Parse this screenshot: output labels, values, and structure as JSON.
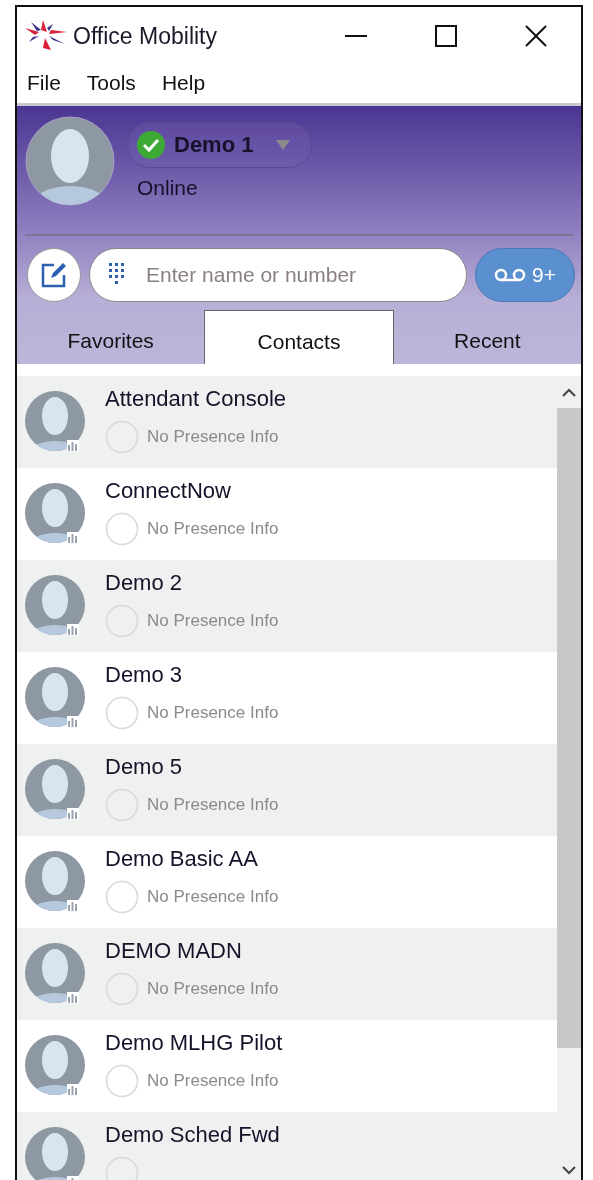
{
  "window": {
    "title": "Office Mobility"
  },
  "menu": [
    "File",
    "Tools",
    "Help"
  ],
  "profile": {
    "name": "Demo 1",
    "available": true,
    "status_text": "Online"
  },
  "search": {
    "placeholder": "Enter name or number"
  },
  "voicemail": {
    "count": "9+"
  },
  "tabs": [
    {
      "label": "Favorites",
      "selected": false
    },
    {
      "label": "Contacts",
      "selected": true
    },
    {
      "label": "Recent",
      "selected": false
    }
  ],
  "contacts": [
    {
      "name": "Attendant Console",
      "presence": "No Presence Info"
    },
    {
      "name": "ConnectNow",
      "presence": "No Presence Info"
    },
    {
      "name": "Demo 2",
      "presence": "No Presence Info"
    },
    {
      "name": "Demo 3",
      "presence": "No Presence Info"
    },
    {
      "name": "Demo 5",
      "presence": "No Presence Info"
    },
    {
      "name": "Demo Basic AA",
      "presence": "No Presence Info"
    },
    {
      "name": "DEMO MADN",
      "presence": "No Presence Info"
    },
    {
      "name": "Demo MLHG Pilot",
      "presence": "No Presence Info"
    },
    {
      "name": "Demo Sched Fwd"
    }
  ]
}
